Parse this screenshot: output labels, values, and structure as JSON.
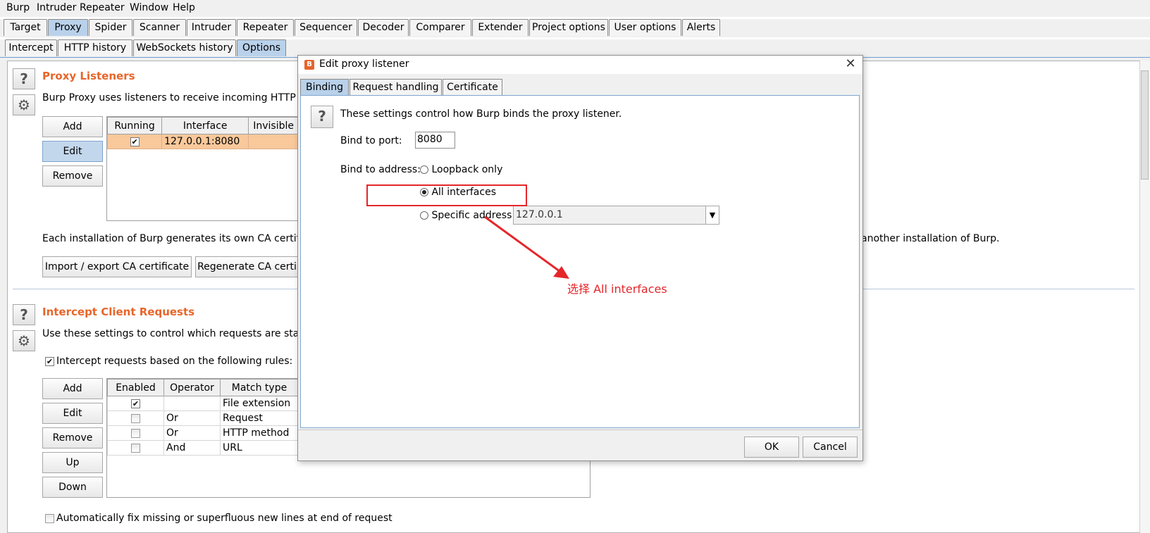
{
  "menu": [
    "Burp",
    "Intruder",
    "Repeater",
    "Window",
    "Help"
  ],
  "top_tabs": [
    "Target",
    "Proxy",
    "Spider",
    "Scanner",
    "Intruder",
    "Repeater",
    "Sequencer",
    "Decoder",
    "Comparer",
    "Extender",
    "Project options",
    "User options",
    "Alerts"
  ],
  "top_tabs_active": "Proxy",
  "sub_tabs": [
    "Intercept",
    "HTTP history",
    "WebSockets history",
    "Options"
  ],
  "sub_tabs_active": "Options",
  "help_icon": "question-icon",
  "settings_icon": "gear-icon",
  "proxy_listeners": {
    "title": "Proxy Listeners",
    "description": "Burp Proxy uses listeners to receive incoming HTTP reque",
    "buttons": [
      "Add",
      "Edit",
      "Remove"
    ],
    "columns": [
      "Running",
      "Interface",
      "Invisible"
    ],
    "rows": [
      {
        "running": true,
        "interface": "127.0.0.1:8080",
        "invisible": ""
      }
    ],
    "ca_text_left": "Each installation of Burp generates its own CA certificate t",
    "ca_text_right": "another installation of Burp.",
    "import_button": "Import / export CA certificate",
    "regenerate_button": "Regenerate CA certi"
  },
  "intercept_requests": {
    "title": "Intercept Client Requests",
    "description": "Use these settings to control which requests are stalled fo",
    "checkbox_label": "Intercept requests based on the following rules:",
    "checkbox_checked": true,
    "buttons": [
      "Add",
      "Edit",
      "Remove",
      "Up",
      "Down"
    ],
    "columns": [
      "Enabled",
      "Operator",
      "Match type"
    ],
    "rows": [
      {
        "enabled": true,
        "operator": "",
        "match": "File extension"
      },
      {
        "enabled": false,
        "operator": "Or",
        "match": "Request"
      },
      {
        "enabled": false,
        "operator": "Or",
        "match": "HTTP method"
      },
      {
        "enabled": false,
        "operator": "And",
        "match": "URL"
      }
    ],
    "autofix_label": "Automatically fix missing or superfluous new lines at end of request"
  },
  "dialog": {
    "title": "Edit proxy listener",
    "close_glyph": "✕",
    "tabs": [
      "Binding",
      "Request handling",
      "Certificate"
    ],
    "active_tab": "Binding",
    "description": "These settings control how Burp binds the proxy listener.",
    "port_label": "Bind to port:",
    "port_value": "8080",
    "address_label": "Bind to address:",
    "options": {
      "loopback": "Loopback only",
      "all": "All interfaces",
      "specific": "Specific address:"
    },
    "selected_option": "all",
    "specific_value": "127.0.0.1",
    "ok": "OK",
    "cancel": "Cancel"
  },
  "annotation": {
    "text": "选择 All interfaces",
    "color": "#e5262a"
  },
  "colors": {
    "accent_title": "#e8652a",
    "selected_row": "#f9c89b",
    "active_tab": "#b9d1ea"
  }
}
